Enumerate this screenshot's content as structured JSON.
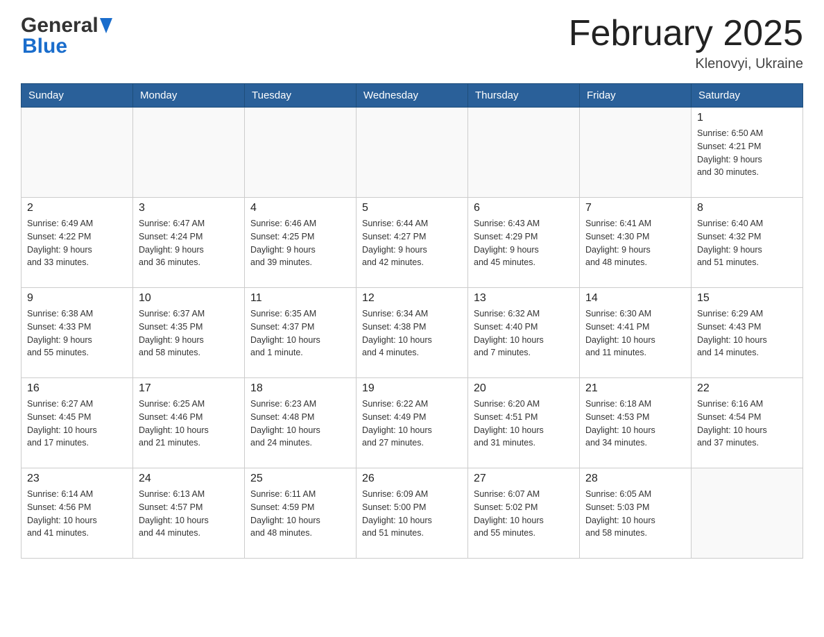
{
  "header": {
    "title": "February 2025",
    "subtitle": "Klenovyi, Ukraine",
    "logo_general": "General",
    "logo_blue": "Blue"
  },
  "days_of_week": [
    "Sunday",
    "Monday",
    "Tuesday",
    "Wednesday",
    "Thursday",
    "Friday",
    "Saturday"
  ],
  "weeks": [
    [
      {
        "day": "",
        "info": ""
      },
      {
        "day": "",
        "info": ""
      },
      {
        "day": "",
        "info": ""
      },
      {
        "day": "",
        "info": ""
      },
      {
        "day": "",
        "info": ""
      },
      {
        "day": "",
        "info": ""
      },
      {
        "day": "1",
        "info": "Sunrise: 6:50 AM\nSunset: 4:21 PM\nDaylight: 9 hours\nand 30 minutes."
      }
    ],
    [
      {
        "day": "2",
        "info": "Sunrise: 6:49 AM\nSunset: 4:22 PM\nDaylight: 9 hours\nand 33 minutes."
      },
      {
        "day": "3",
        "info": "Sunrise: 6:47 AM\nSunset: 4:24 PM\nDaylight: 9 hours\nand 36 minutes."
      },
      {
        "day": "4",
        "info": "Sunrise: 6:46 AM\nSunset: 4:25 PM\nDaylight: 9 hours\nand 39 minutes."
      },
      {
        "day": "5",
        "info": "Sunrise: 6:44 AM\nSunset: 4:27 PM\nDaylight: 9 hours\nand 42 minutes."
      },
      {
        "day": "6",
        "info": "Sunrise: 6:43 AM\nSunset: 4:29 PM\nDaylight: 9 hours\nand 45 minutes."
      },
      {
        "day": "7",
        "info": "Sunrise: 6:41 AM\nSunset: 4:30 PM\nDaylight: 9 hours\nand 48 minutes."
      },
      {
        "day": "8",
        "info": "Sunrise: 6:40 AM\nSunset: 4:32 PM\nDaylight: 9 hours\nand 51 minutes."
      }
    ],
    [
      {
        "day": "9",
        "info": "Sunrise: 6:38 AM\nSunset: 4:33 PM\nDaylight: 9 hours\nand 55 minutes."
      },
      {
        "day": "10",
        "info": "Sunrise: 6:37 AM\nSunset: 4:35 PM\nDaylight: 9 hours\nand 58 minutes."
      },
      {
        "day": "11",
        "info": "Sunrise: 6:35 AM\nSunset: 4:37 PM\nDaylight: 10 hours\nand 1 minute."
      },
      {
        "day": "12",
        "info": "Sunrise: 6:34 AM\nSunset: 4:38 PM\nDaylight: 10 hours\nand 4 minutes."
      },
      {
        "day": "13",
        "info": "Sunrise: 6:32 AM\nSunset: 4:40 PM\nDaylight: 10 hours\nand 7 minutes."
      },
      {
        "day": "14",
        "info": "Sunrise: 6:30 AM\nSunset: 4:41 PM\nDaylight: 10 hours\nand 11 minutes."
      },
      {
        "day": "15",
        "info": "Sunrise: 6:29 AM\nSunset: 4:43 PM\nDaylight: 10 hours\nand 14 minutes."
      }
    ],
    [
      {
        "day": "16",
        "info": "Sunrise: 6:27 AM\nSunset: 4:45 PM\nDaylight: 10 hours\nand 17 minutes."
      },
      {
        "day": "17",
        "info": "Sunrise: 6:25 AM\nSunset: 4:46 PM\nDaylight: 10 hours\nand 21 minutes."
      },
      {
        "day": "18",
        "info": "Sunrise: 6:23 AM\nSunset: 4:48 PM\nDaylight: 10 hours\nand 24 minutes."
      },
      {
        "day": "19",
        "info": "Sunrise: 6:22 AM\nSunset: 4:49 PM\nDaylight: 10 hours\nand 27 minutes."
      },
      {
        "day": "20",
        "info": "Sunrise: 6:20 AM\nSunset: 4:51 PM\nDaylight: 10 hours\nand 31 minutes."
      },
      {
        "day": "21",
        "info": "Sunrise: 6:18 AM\nSunset: 4:53 PM\nDaylight: 10 hours\nand 34 minutes."
      },
      {
        "day": "22",
        "info": "Sunrise: 6:16 AM\nSunset: 4:54 PM\nDaylight: 10 hours\nand 37 minutes."
      }
    ],
    [
      {
        "day": "23",
        "info": "Sunrise: 6:14 AM\nSunset: 4:56 PM\nDaylight: 10 hours\nand 41 minutes."
      },
      {
        "day": "24",
        "info": "Sunrise: 6:13 AM\nSunset: 4:57 PM\nDaylight: 10 hours\nand 44 minutes."
      },
      {
        "day": "25",
        "info": "Sunrise: 6:11 AM\nSunset: 4:59 PM\nDaylight: 10 hours\nand 48 minutes."
      },
      {
        "day": "26",
        "info": "Sunrise: 6:09 AM\nSunset: 5:00 PM\nDaylight: 10 hours\nand 51 minutes."
      },
      {
        "day": "27",
        "info": "Sunrise: 6:07 AM\nSunset: 5:02 PM\nDaylight: 10 hours\nand 55 minutes."
      },
      {
        "day": "28",
        "info": "Sunrise: 6:05 AM\nSunset: 5:03 PM\nDaylight: 10 hours\nand 58 minutes."
      },
      {
        "day": "",
        "info": ""
      }
    ]
  ]
}
